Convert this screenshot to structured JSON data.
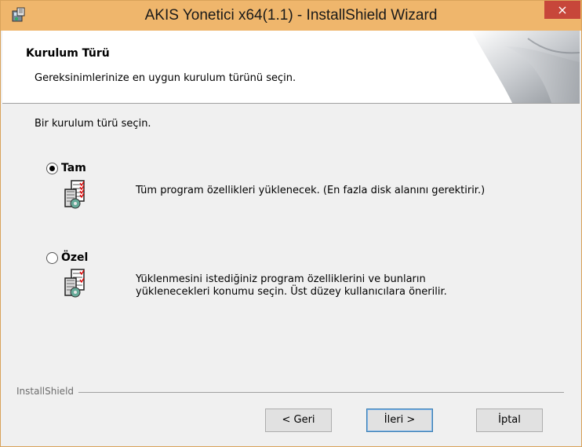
{
  "window": {
    "title": "AKIS Yonetici x64(1.1) - InstallShield Wizard",
    "close_glyph": "×",
    "title_color": "#efb66c"
  },
  "header": {
    "title": "Kurulum Türü",
    "subtitle": "Gereksinimlerinize en uygun kurulum türünü seçin."
  },
  "body": {
    "prompt": "Bir kurulum türü seçin.",
    "options": [
      {
        "label": "Tam",
        "selected": true,
        "description": "Tüm program özellikleri yüklenecek. (En fazla disk alanını gerektirir.)",
        "icon": "setup-full-icon"
      },
      {
        "label": "Özel",
        "selected": false,
        "description_line1": "Yüklenmesini istediğiniz program özelliklerini ve bunların",
        "description_line2": "yüklenecekleri konumu seçin. Üst düzey kullanıcılara önerilir.",
        "icon": "setup-custom-icon"
      }
    ]
  },
  "footer": {
    "brand": "InstallShield",
    "back_label": "< Geri",
    "next_label": "İleri >",
    "cancel_label": "İptal"
  }
}
